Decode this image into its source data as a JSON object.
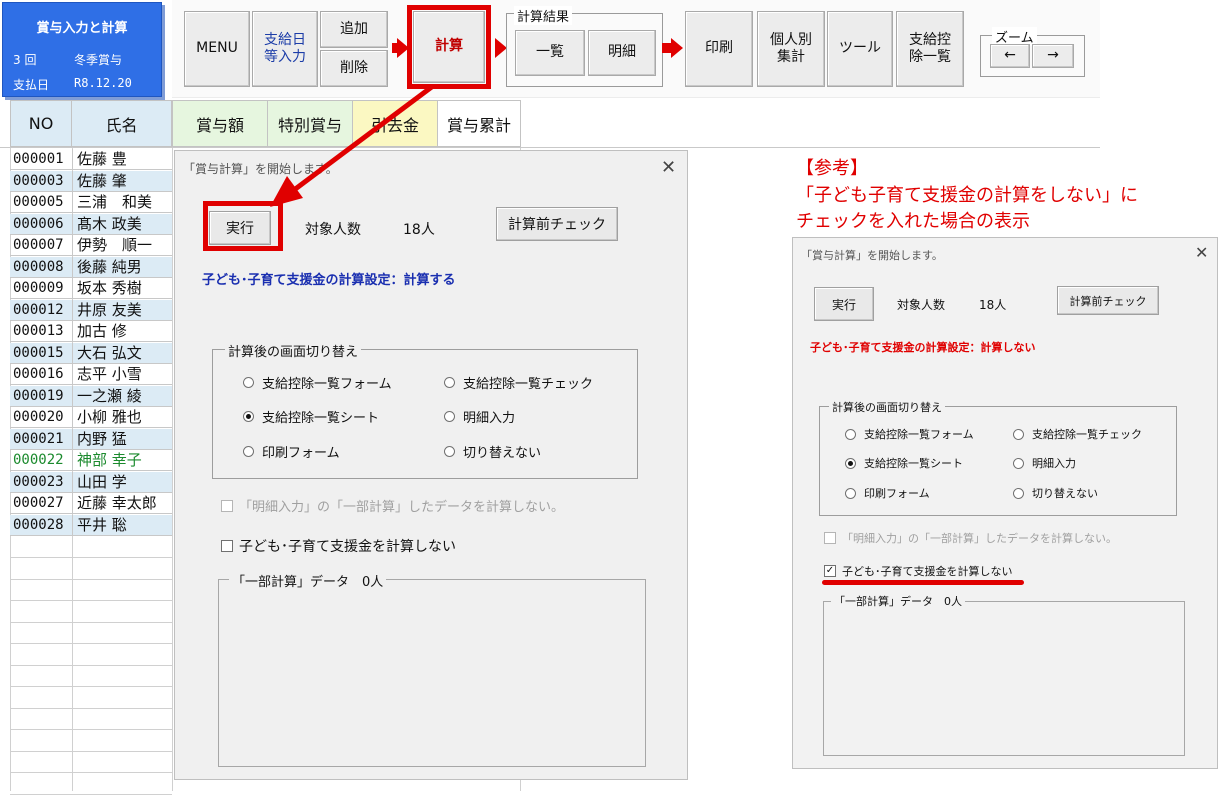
{
  "info": {
    "title": "賞与入力と計算",
    "round": "3 回",
    "season": "冬季賞与",
    "pay_label": "支払日",
    "pay_date": "R8.12.20"
  },
  "toolbar": {
    "menu": "MENU",
    "shikyubi_1": "支給日",
    "shikyubi_2": "等入力",
    "add": "追加",
    "delete": "削除",
    "calc": "計算",
    "result_group": "計算結果",
    "list": "一覧",
    "detail": "明細",
    "print": "印刷",
    "personal_1": "個人別",
    "personal_2": "集計",
    "tools": "ツール",
    "deduction_1": "支給控",
    "deduction_2": "除一覧",
    "zoom_group": "ズーム",
    "zoom_left": "←",
    "zoom_right": "→"
  },
  "sheet": {
    "headers": [
      "NO",
      "氏名",
      "賞与額",
      "特別賞与",
      "引去金",
      "賞与累計"
    ],
    "rows": [
      {
        "no": "000001",
        "name": "佐藤 豊"
      },
      {
        "no": "000003",
        "name": "佐藤 肇"
      },
      {
        "no": "000005",
        "name": "三浦　和美"
      },
      {
        "no": "000006",
        "name": "髙木 政美"
      },
      {
        "no": "000007",
        "name": "伊勢　順一"
      },
      {
        "no": "000008",
        "name": "後藤 純男"
      },
      {
        "no": "000009",
        "name": "坂本 秀樹"
      },
      {
        "no": "000012",
        "name": "井原 友美"
      },
      {
        "no": "000013",
        "name": "加古 修"
      },
      {
        "no": "000015",
        "name": "大石 弘文"
      },
      {
        "no": "000016",
        "name": "志平 小雪"
      },
      {
        "no": "000019",
        "name": "一之瀬 綾"
      },
      {
        "no": "000020",
        "name": "小柳 雅也"
      },
      {
        "no": "000021",
        "name": "内野 猛"
      },
      {
        "no": "000022",
        "name": "神部 幸子"
      },
      {
        "no": "000023",
        "name": "山田 学"
      },
      {
        "no": "000027",
        "name": "近藤 幸太郎"
      },
      {
        "no": "000028",
        "name": "平井 聡"
      }
    ]
  },
  "dialog_main": {
    "title": "「賞与計算」を開始します。",
    "close": "✕",
    "run": "実行",
    "target_label": "対象人数",
    "target_count": "18人",
    "precheck": "計算前チェック",
    "setting": "子ども･子育て支援金の計算設定：計算する",
    "switch_legend": "計算後の画面切り替え",
    "options": [
      "支給控除一覧フォーム",
      "支給控除一覧チェック",
      "支給控除一覧シート",
      "明細入力",
      "印刷フォーム",
      "切り替えない"
    ],
    "no_partial": "「明細入力」の「一部計算」したデータを計算しない。",
    "no_kodomo": "子ども･子育て支援金を計算しない",
    "partial_legend": "「一部計算」データ　0人"
  },
  "dialog_ref": {
    "title": "「賞与計算」を開始します。",
    "close": "✕",
    "run": "実行",
    "target_label": "対象人数",
    "target_count": "18人",
    "precheck": "計算前チェック",
    "setting": "子ども･子育て支援金の計算設定：計算しない",
    "switch_legend": "計算後の画面切り替え",
    "options": [
      "支給控除一覧フォーム",
      "支給控除一覧チェック",
      "支給控除一覧シート",
      "明細入力",
      "印刷フォーム",
      "切り替えない"
    ],
    "no_partial": "「明細入力」の「一部計算」したデータを計算しない。",
    "no_kodomo": "子ども･子育て支援金を計算しない",
    "partial_legend": "「一部計算」データ　0人"
  },
  "annotation": {
    "line1": "【参考】",
    "line2": "「子ども子育て支援金の計算をしない」に",
    "line3": "チェックを入れた場合の表示"
  },
  "colors": {
    "accent_red": "#e00000",
    "info_blue": "#2f6fe6",
    "setting_blue": "#1a2fb0"
  }
}
